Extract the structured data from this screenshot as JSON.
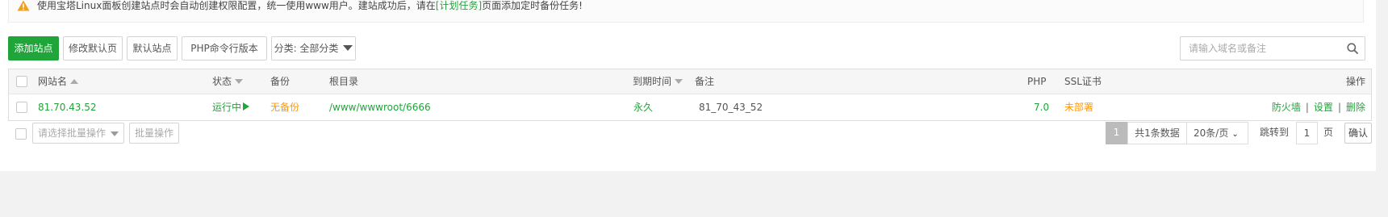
{
  "notice": {
    "text_before": "使用宝塔Linux面板创建站点时会自动创建权限配置，统一使用www用户。建站成功后，请在",
    "link_text": "[计划任务]",
    "text_after": "页面添加定时备份任务!"
  },
  "toolbar": {
    "add_site": "添加站点",
    "edit_default_page": "修改默认页",
    "default_site": "默认站点",
    "php_cli_version": "PHP命令行版本",
    "category_select": "分类: 全部分类"
  },
  "search": {
    "placeholder": "请输入域名或备注"
  },
  "table": {
    "headers": {
      "site_name": "网站名",
      "status": "状态",
      "backup": "备份",
      "root_dir": "根目录",
      "expire": "到期时间",
      "remark": "备注",
      "php": "PHP",
      "ssl": "SSL证书",
      "actions": "操作"
    },
    "rows": [
      {
        "site_name": "81.70.43.52",
        "status": "运行中",
        "backup": "无备份",
        "root_dir": "/www/wwwroot/6666",
        "expire": "永久",
        "remark": "81_70_43_52",
        "php": "7.0",
        "ssl": "未部署",
        "action_firewall": "防火墙",
        "action_settings": "设置",
        "action_delete": "删除"
      }
    ]
  },
  "footer": {
    "batch_select_placeholder": "请选择批量操作",
    "batch_button": "批量操作",
    "pager": {
      "current_page": "1",
      "total_text": "共1条数据",
      "page_size": "20条/页",
      "jump_label": "跳转到",
      "jump_value": "1",
      "page_unit": "页",
      "confirm": "确认"
    }
  },
  "colors": {
    "accent": "#20a53a",
    "warning": "#ff9900"
  }
}
